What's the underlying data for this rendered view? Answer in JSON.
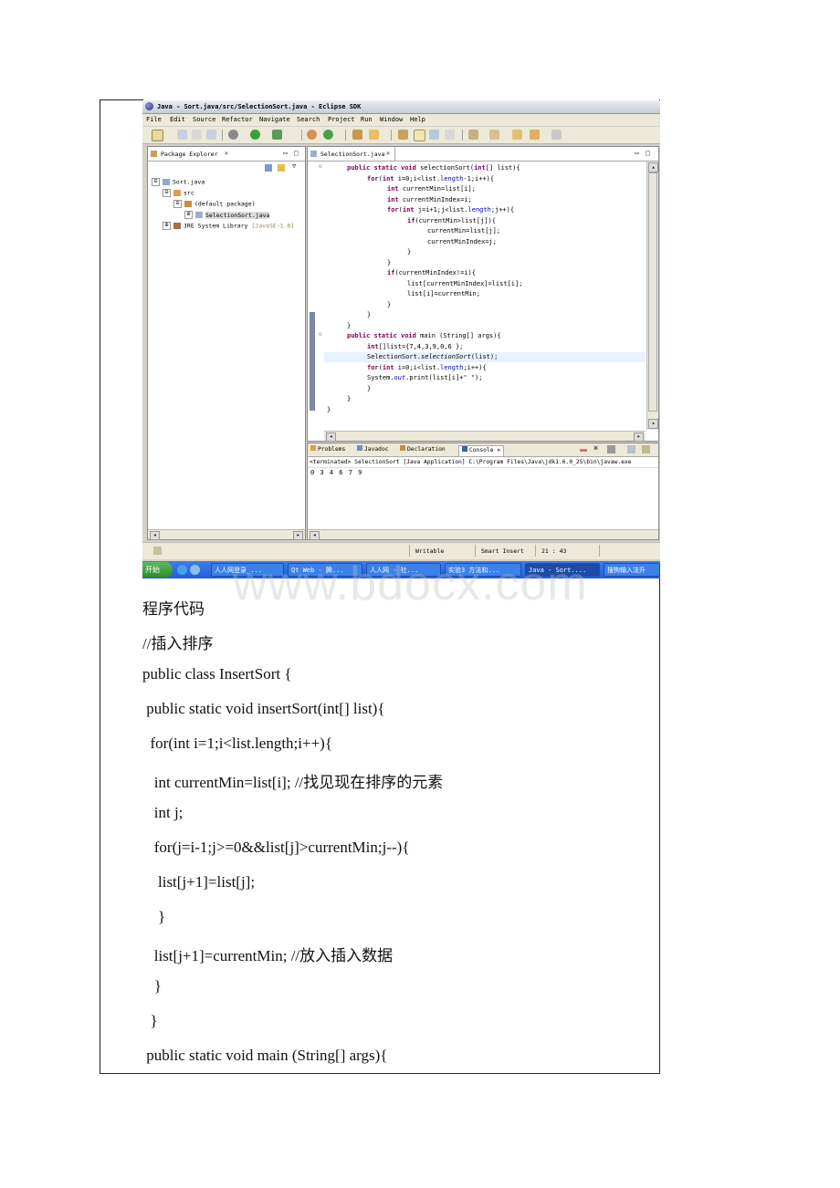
{
  "eclipse": {
    "title": "Java - Sort.java/src/SelectionSort.java - Eclipse SDK",
    "menu": [
      "File",
      "Edit",
      "Source",
      "Refactor",
      "Navigate",
      "Search",
      "Project",
      "Run",
      "Window",
      "Help"
    ],
    "package_explorer": {
      "tab_label": "Package Explorer",
      "tree": [
        {
          "label": "Sort.java",
          "expander": "⊟"
        },
        {
          "label": "src",
          "expander": "⊟"
        },
        {
          "label": "(default package)",
          "expander": "⊟"
        },
        {
          "label": "SelectionSort.java",
          "expander": "⊞"
        },
        {
          "label": "JRE System Library",
          "suffix": "[JavaSE-1.6]",
          "expander": "⊞"
        }
      ]
    },
    "editor": {
      "tab_label": "SelectionSort.java",
      "lines": [
        "public static void selectionSort(int[] list){",
        "    for(int i=0;i<list.length-1;i++){",
        "        int currentMin=list[i];",
        "        int currentMinIndex=i;",
        "        for(int j=i+1;j<list.length;j++){",
        "            if(currentMin>list[j]){",
        "                currentMin=list[j];",
        "                currentMinIndex=j;",
        "            }",
        "        }",
        "        if(currentMinIndex!=i){",
        "            list[currentMinIndex]=list[i];",
        "            list[i]=currentMin;",
        "        }",
        "    }",
        "}",
        "public static void main (String[] args){",
        "    int[]list={7,4,3,9,0,6 };",
        "    SelectionSort.selectionSort(list);",
        "    for(int i=0;i<list.length;i++){",
        "    System.out.print(list[i]+\" \");",
        "    }",
        "}",
        "}"
      ]
    },
    "console": {
      "tabs": [
        "Problems",
        "Javadoc",
        "Declaration",
        "Console"
      ],
      "terminated": "<terminated> SelectionSort [Java Application] C:\\Program Files\\Java\\jdk1.6.0_25\\bin\\javaw.exe",
      "output": "0 3 4 6 7 9"
    },
    "status": {
      "writable": "Writable",
      "insert_mode": "Smart Insert",
      "position": "21 : 43"
    },
    "taskbar": {
      "start": "开始",
      "items": [
        "人人网登录_...",
        "Qt Web - 腾...",
        "人人网 - 社...",
        "实验3 方法和...",
        "Java - Sort....",
        "搜狗输入法升"
      ]
    }
  },
  "document": {
    "heading": "程序代码",
    "lines": [
      "//插入排序",
      "public class InsertSort {",
      " public static void insertSort(int[] list){",
      "  for(int i=1;i<list.length;i++){",
      "   int currentMin=list[i]; //找见现在排序的元素",
      "   int j;",
      "   for(j=i-1;j>=0&&list[j]>currentMin;j--){",
      "    list[j+1]=list[j];",
      "    }",
      "   list[j+1]=currentMin; //放入插入数据",
      "   }",
      "  }",
      " public static void main (String[] args){"
    ]
  },
  "watermark": "www.bdocx.com"
}
